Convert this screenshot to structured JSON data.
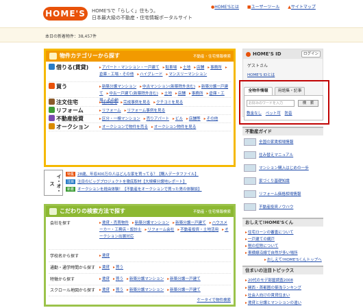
{
  "header": {
    "logo": "HOME'S",
    "tagline1": "HOME'Sで「らしく」住もう。",
    "tagline2": "日本最大級の不動産・住宅情報ポータルサイト",
    "links": [
      "HOME'Sとは",
      "ユーザーツール",
      "サイトマップ"
    ]
  },
  "count_text": "本日の新着物件：38,457件",
  "category": {
    "title": "物件カテゴリーから探す",
    "right": "不動産・住宅情報検索",
    "rows": [
      {
        "label": "借りる(賃貸)",
        "color": "#2a7cc7",
        "links": [
          "アパート・マンション・一戸建て",
          "駐車場",
          "土地",
          "店舗",
          "事務所",
          "倉庫・工場・その他",
          "ハイグレード",
          "マンスリーマンション"
        ]
      },
      {
        "label": "買う",
        "color": "#e8520a",
        "links": [
          "新築分譲マンション",
          "中古マンション(新築除外含む)",
          "新築分譲一戸建て",
          "中古一戸建て(新築除外含む)",
          "土地",
          "店舗",
          "事務所",
          "倉庫・工場・その他"
        ]
      },
      {
        "label": "注文住宅",
        "color": "#8a5a2b",
        "links": [
          "注文住宅",
          "完成事例を見る",
          "クチコミを見る"
        ]
      },
      {
        "label": "リフォーム",
        "color": "#3d9b35",
        "links": [
          "リフォーム",
          "リフォーム事例を見る"
        ]
      },
      {
        "label": "不動産投資",
        "color": "#7a4ab0",
        "links": [
          "区分・一棟マンション",
          "売りアパート",
          "ビル",
          "店舗等",
          "その他"
        ]
      },
      {
        "label": "オークション",
        "color": "#d98a00",
        "links": [
          "オークションで物件を売る",
          "オークション物件を見る"
        ]
      }
    ]
  },
  "promo": {
    "image_text": "イ・オ・ス",
    "items": [
      {
        "badge": "特集",
        "badge_color": "#e8520a",
        "text": "28歳、年収400万の人はどんな家を買ってる？【購入データファイル】"
      },
      {
        "badge": "注目",
        "badge_color": "#2a7cc7",
        "text": "注目のビッグプロジェクトを徹底取材【大規模分譲地レポート】"
      },
      {
        "badge": "新着",
        "badge_color": "#3d9b35",
        "text": "オークションを経由体験！【不動産をオークションで買った男の体験談】"
      }
    ]
  },
  "search": {
    "title": "こだわりの検索方法で探す",
    "right": "不動産・住宅情報検索",
    "rows": [
      {
        "label": "会社を探す",
        "links": [
          "賃貸・売買物件",
          "新築分譲マンション",
          "新築分譲一戸建て",
          "ハウスメーカー・工務店・設計士",
          "リフォーム会社",
          "不動産投資・土地活用",
          "オークション出展対応"
        ]
      },
      {
        "label": "学校名から探す",
        "links": [
          "賃貸"
        ]
      },
      {
        "label": "通勤・通学時間から探す",
        "links": [
          "賃貸",
          "買う"
        ]
      },
      {
        "label": "特徴から探す",
        "links": [
          "賃貸",
          "買う",
          "新築分譲マンション",
          "新築分譲一戸建て"
        ]
      },
      {
        "label": "スクロール地図から探す",
        "links": [
          "賃貸",
          "買う",
          "新築分譲マンション",
          "新築分譲一戸建て"
        ]
      }
    ],
    "mobile": "ケータイで物件検索"
  },
  "id_box": {
    "title": "HOME'S ID",
    "login": "ログイン",
    "guest": "ゲストさん",
    "what": "HOME'S IDとは",
    "tabs": [
      "全物件情報",
      "用語集・記事"
    ],
    "placeholder": "お好みのワードを入力",
    "search_btn": "検　索",
    "hints": [
      "敷金なし",
      "ペット可",
      "防音"
    ]
  },
  "guide": {
    "title": "不動産ガイド",
    "items": [
      "全国の家賃相場情報",
      "住み替えマニュアル",
      "マンション購入はじめの一歩",
      "家づくり基礎知識",
      "リフォーム価格相場情報",
      "不動産投資ノウハウ"
    ]
  },
  "oshiete": {
    "title": "おしえて!HOME'Sくん",
    "items": [
      "住宅ローンの審査について",
      "一戸建ての網戸",
      "税の控除について",
      "東横線沿線で自然が多い場所",
      "おしえて!HOME'Sくんトップへ"
    ]
  },
  "chuumoku": {
    "title": "住まいの注目トピックス",
    "items": [
      "20代のモデ部屋調査2008",
      "関西・首都圏の築浅ランキング",
      "社会人向けの賃貸住まい",
      "賃貸と分譲とマンションの違い"
    ]
  }
}
